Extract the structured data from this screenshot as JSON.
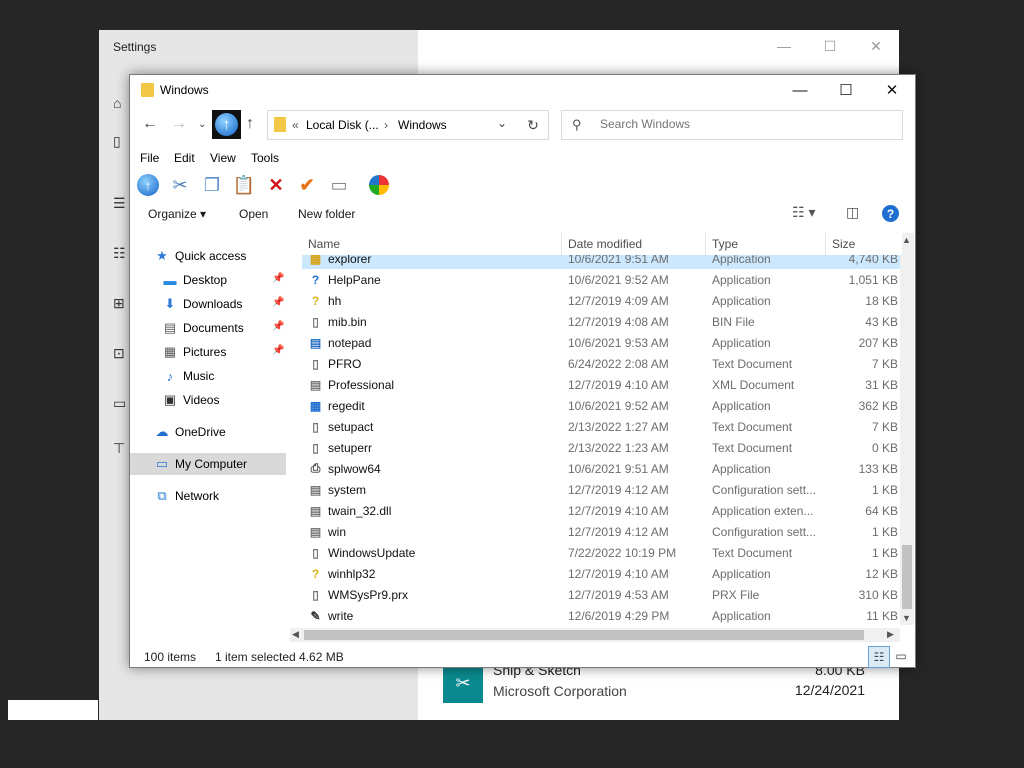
{
  "settings": {
    "title": "Settings",
    "controls": [
      "—",
      "☐",
      "✕"
    ],
    "left_icons": [
      "⌂",
      "▯",
      "☰",
      "☷",
      "⊞",
      "⊡",
      "▭",
      "⊤"
    ],
    "snip_app": {
      "name": "Snip & Sketch",
      "publisher": "Microsoft Corporation",
      "size": "8.00 KB",
      "date": "12/24/2021"
    }
  },
  "explorer": {
    "title": "Windows",
    "controls": [
      "—",
      "☐",
      "✕"
    ],
    "address": {
      "prefix": "«",
      "seg1": "Local Disk (...",
      "sep": "›",
      "seg2": "Windows"
    },
    "search_placeholder": "Search Windows",
    "menu": [
      "File",
      "Edit",
      "View",
      "Tools"
    ],
    "commands": {
      "organize": "Organize ▾",
      "open": "Open",
      "new_folder": "New folder"
    },
    "columns": {
      "name": "Name",
      "date": "Date modified",
      "type": "Type",
      "size": "Size"
    },
    "nav": [
      {
        "label": "Quick access",
        "icon": "★",
        "color": "#2a7ad5",
        "indent": 0,
        "pin": false
      },
      {
        "label": "Desktop",
        "icon": "▬",
        "color": "#2a8ae0",
        "indent": 1,
        "pin": true
      },
      {
        "label": "Downloads",
        "icon": "⬇",
        "color": "#2a7ad5",
        "indent": 1,
        "pin": true
      },
      {
        "label": "Documents",
        "icon": "▤",
        "color": "#5a5a5a",
        "indent": 1,
        "pin": true
      },
      {
        "label": "Pictures",
        "icon": "▦",
        "color": "#5a5a5a",
        "indent": 1,
        "pin": true
      },
      {
        "label": "Music",
        "icon": "♪",
        "color": "#2a7ad5",
        "indent": 1,
        "pin": false
      },
      {
        "label": "Videos",
        "icon": "▣",
        "color": "#333",
        "indent": 1,
        "pin": false
      },
      {
        "label": "OneDrive",
        "icon": "☁",
        "color": "#1f6fd1",
        "indent": 0,
        "pin": false
      },
      {
        "label": "My Computer",
        "icon": "▭",
        "color": "#2a7ad5",
        "indent": 0,
        "pin": false,
        "selected": true
      },
      {
        "label": "Network",
        "icon": "⧉",
        "color": "#2a7ad5",
        "indent": 0,
        "pin": false
      }
    ],
    "files": [
      {
        "name": "explorer",
        "date": "10/6/2021 9:51 AM",
        "type": "Application",
        "size": "4,740 KB",
        "icon": "▦",
        "color": "#d9a21b",
        "selected": true
      },
      {
        "name": "HelpPane",
        "date": "10/6/2021 9:52 AM",
        "type": "Application",
        "size": "1,051 KB",
        "icon": "?",
        "color": "#1f6fd1"
      },
      {
        "name": "hh",
        "date": "12/7/2019 4:09 AM",
        "type": "Application",
        "size": "18 KB",
        "icon": "?",
        "color": "#d9b21b"
      },
      {
        "name": "mib.bin",
        "date": "12/7/2019 4:08 AM",
        "type": "BIN File",
        "size": "43 KB",
        "icon": "▯",
        "color": "#777"
      },
      {
        "name": "notepad",
        "date": "10/6/2021 9:53 AM",
        "type": "Application",
        "size": "207 KB",
        "icon": "▤",
        "color": "#2a6fc0"
      },
      {
        "name": "PFRO",
        "date": "6/24/2022 2:08 AM",
        "type": "Text Document",
        "size": "7 KB",
        "icon": "▯",
        "color": "#777"
      },
      {
        "name": "Professional",
        "date": "12/7/2019 4:10 AM",
        "type": "XML Document",
        "size": "31 KB",
        "icon": "▤",
        "color": "#777"
      },
      {
        "name": "regedit",
        "date": "10/6/2021 9:52 AM",
        "type": "Application",
        "size": "362 KB",
        "icon": "▦",
        "color": "#1f6fd1"
      },
      {
        "name": "setupact",
        "date": "2/13/2022 1:27 AM",
        "type": "Text Document",
        "size": "7 KB",
        "icon": "▯",
        "color": "#777"
      },
      {
        "name": "setuperr",
        "date": "2/13/2022 1:23 AM",
        "type": "Text Document",
        "size": "0 KB",
        "icon": "▯",
        "color": "#777"
      },
      {
        "name": "splwow64",
        "date": "10/6/2021 9:51 AM",
        "type": "Application",
        "size": "133 KB",
        "icon": "⎙",
        "color": "#555"
      },
      {
        "name": "system",
        "date": "12/7/2019 4:12 AM",
        "type": "Configuration sett...",
        "size": "1 KB",
        "icon": "▤",
        "color": "#777"
      },
      {
        "name": "twain_32.dll",
        "date": "12/7/2019 4:10 AM",
        "type": "Application exten...",
        "size": "64 KB",
        "icon": "▤",
        "color": "#777"
      },
      {
        "name": "win",
        "date": "12/7/2019 4:12 AM",
        "type": "Configuration sett...",
        "size": "1 KB",
        "icon": "▤",
        "color": "#777"
      },
      {
        "name": "WindowsUpdate",
        "date": "7/22/2022 10:19 PM",
        "type": "Text Document",
        "size": "1 KB",
        "icon": "▯",
        "color": "#777"
      },
      {
        "name": "winhlp32",
        "date": "12/7/2019 4:10 AM",
        "type": "Application",
        "size": "12 KB",
        "icon": "?",
        "color": "#d9b21b"
      },
      {
        "name": "WMSysPr9.prx",
        "date": "12/7/2019 4:53 AM",
        "type": "PRX File",
        "size": "310 KB",
        "icon": "▯",
        "color": "#777"
      },
      {
        "name": "write",
        "date": "12/6/2019 4:29 PM",
        "type": "Application",
        "size": "11 KB",
        "icon": "✎",
        "color": "#333"
      }
    ],
    "status": {
      "items": "100 items",
      "selected": "1 item selected  4.62 MB"
    }
  }
}
